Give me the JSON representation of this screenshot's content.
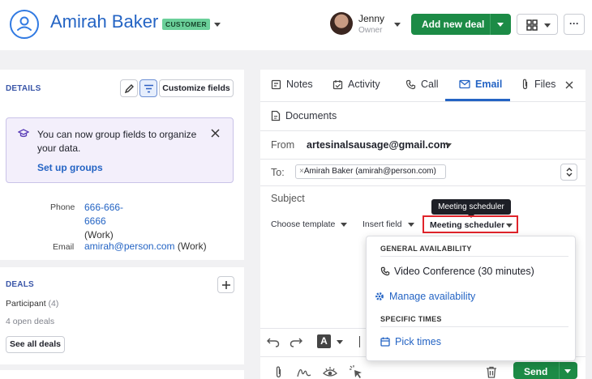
{
  "header": {
    "person_name": "Amirah Baker",
    "badge": "CUSTOMER",
    "owner_name": "Jenny",
    "owner_role": "Owner",
    "add_deal_label": "Add new deal",
    "more_label": "···"
  },
  "details": {
    "title": "DETAILS",
    "customize_label": "Customize fields",
    "notice_text": "You can now group fields to organize your data.",
    "setup_link": "Set up groups",
    "phone_label": "Phone",
    "phone_value": "666-666-6666",
    "phone_type": "(Work)",
    "email_label": "Email",
    "email_value": "amirah@person.com",
    "email_type": "(Work)"
  },
  "deals": {
    "title": "DEALS",
    "participant_label": "Participant",
    "participant_count": "(4)",
    "open_deals": "4 open deals",
    "see_all_label": "See all deals"
  },
  "composer": {
    "tabs": [
      {
        "label": "Notes",
        "icon": "notes-icon"
      },
      {
        "label": "Activity",
        "icon": "activity-icon"
      },
      {
        "label": "Call",
        "icon": "phone-icon"
      },
      {
        "label": "Email",
        "icon": "email-icon"
      },
      {
        "label": "Files",
        "icon": "paperclip-icon"
      }
    ],
    "documents_label": "Documents",
    "from_label": "From",
    "from_value": "artesinalsausage@gmail.com",
    "to_label": "To:",
    "to_chip": "Amirah Baker (amirah@person.com)",
    "subject_placeholder": "Subject",
    "choose_template": "Choose template",
    "insert_field": "Insert field",
    "meeting_scheduler": "Meeting scheduler",
    "tooltip": "Meeting scheduler",
    "send_label": "Send",
    "format_label": "A"
  },
  "dropdown": {
    "general_heading": "GENERAL AVAILABILITY",
    "video_conference": "Video Conference (30 minutes)",
    "manage_availability": "Manage availability",
    "specific_heading": "SPECIFIC TIMES",
    "pick_times": "Pick times"
  },
  "colors": {
    "accent_blue": "#2464c4",
    "green": "#1c8b46",
    "highlight_red": "#e0242b",
    "notice_bg": "#f3effb"
  }
}
